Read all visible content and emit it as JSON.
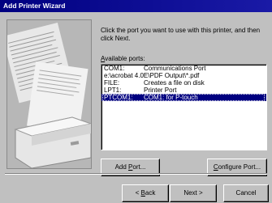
{
  "window": {
    "title": "Add Printer Wizard"
  },
  "main": {
    "instruction": "Click the port you want to use with this printer, and then click Next.",
    "available_ports_label_prefix": "",
    "available_ports_label_mnemonic": "A",
    "available_ports_label_rest": "vailable ports:",
    "ports": [
      {
        "port": "COM1:",
        "description": "Communications Port"
      },
      {
        "port": "e:\\acrobat 4.0E\\PDF Output\\*.pdf",
        "description": ""
      },
      {
        "port": "FILE:",
        "description": "Creates a file on disk"
      },
      {
        "port": "LPT1:",
        "description": "Printer Port"
      },
      {
        "port": "PTCOM1:",
        "description": "COM1: for P-touch",
        "selected": true
      }
    ],
    "add_port_pre": "Add ",
    "add_port_mnemonic": "P",
    "add_port_post": "ort...",
    "configure_pre": "",
    "configure_mnemonic": "C",
    "configure_post": "onfigure Port..."
  },
  "footer": {
    "back_pre": "< ",
    "back_mnemonic": "B",
    "back_post": "ack",
    "next_label": "Next >",
    "cancel_label": "Cancel"
  },
  "colors": {
    "titlebar": "#000080",
    "selection": "#000080",
    "face": "#c0c0c0"
  }
}
